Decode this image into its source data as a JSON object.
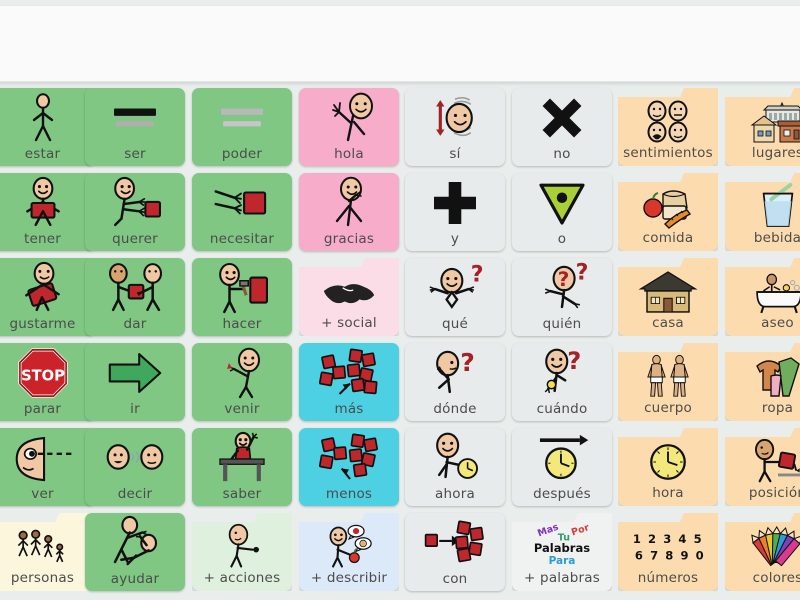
{
  "app": {
    "type": "aac-communication-board",
    "language": "es",
    "columns": 8,
    "rows": 6
  },
  "message_bar": {
    "name": "message-window",
    "value": "",
    "placeholder": ""
  },
  "palette": {
    "verb_green": "#7FC783",
    "social_pink": "#F7ACCA",
    "social_light_pink": "#FBDDE8",
    "question_gray": "#E7EBEC",
    "category_orange": "#FCDCAE",
    "quantity_blue": "#4DD0E1",
    "people_cream": "#FBF6DC",
    "actions_mint": "#DFF0DF",
    "describe_blue": "#DCE9F8",
    "words_gray": "#F0F2F2",
    "board_background": "#E9EDEC",
    "message_background": "#FAFAFA",
    "caption_text": "#4C4C4C"
  },
  "cells": [
    {
      "label": "estar",
      "icon": "standing-person-icon",
      "color": "verb_green",
      "folder": false,
      "row": 1,
      "col": 1
    },
    {
      "label": "ser",
      "icon": "two-bars-icon",
      "color": "verb_green",
      "folder": false,
      "row": 1,
      "col": 2
    },
    {
      "label": "poder",
      "icon": "two-gray-bars-icon",
      "color": "verb_green",
      "folder": false,
      "row": 1,
      "col": 3
    },
    {
      "label": "hola",
      "icon": "waving-person-icon",
      "color": "social_pink",
      "folder": false,
      "row": 1,
      "col": 4
    },
    {
      "label": "sí",
      "icon": "nodding-head-icon",
      "color": "question_gray",
      "folder": false,
      "row": 1,
      "col": 5
    },
    {
      "label": "no",
      "icon": "x-cross-icon",
      "color": "question_gray",
      "folder": false,
      "row": 1,
      "col": 6
    },
    {
      "label": "sentimientos",
      "icon": "four-faces-icon",
      "color": "category_orange",
      "folder": true,
      "row": 1,
      "col": 7
    },
    {
      "label": "lugares",
      "icon": "buildings-icon",
      "color": "category_orange",
      "folder": true,
      "row": 1,
      "col": 8
    },
    {
      "label": "tener",
      "icon": "person-holding-block-icon",
      "color": "verb_green",
      "folder": false,
      "row": 2,
      "col": 1
    },
    {
      "label": "querer",
      "icon": "person-reaching-icon",
      "color": "verb_green",
      "folder": false,
      "row": 2,
      "col": 2
    },
    {
      "label": "necesitar",
      "icon": "hands-grabbing-block-icon",
      "color": "verb_green",
      "folder": false,
      "row": 2,
      "col": 3
    },
    {
      "label": "gracias",
      "icon": "thank-you-sign-icon",
      "color": "social_pink",
      "folder": false,
      "row": 2,
      "col": 4
    },
    {
      "label": "y",
      "icon": "plus-sign-icon",
      "color": "question_gray",
      "folder": false,
      "row": 2,
      "col": 5
    },
    {
      "label": "o",
      "icon": "triangle-dot-icon",
      "color": "question_gray",
      "folder": false,
      "row": 2,
      "col": 6
    },
    {
      "label": "comida",
      "icon": "food-bread-apple-icon",
      "color": "category_orange",
      "folder": true,
      "row": 2,
      "col": 7
    },
    {
      "label": "bebida",
      "icon": "glass-with-straw-icon",
      "color": "category_orange",
      "folder": true,
      "row": 2,
      "col": 8
    },
    {
      "label": "gustarme",
      "icon": "person-hugging-heart-icon",
      "color": "verb_green",
      "folder": false,
      "row": 3,
      "col": 1
    },
    {
      "label": "dar",
      "icon": "two-people-giving-icon",
      "color": "verb_green",
      "folder": false,
      "row": 3,
      "col": 2
    },
    {
      "label": "hacer",
      "icon": "person-hammering-icon",
      "color": "verb_green",
      "folder": false,
      "row": 3,
      "col": 3
    },
    {
      "label": "+ social",
      "icon": "handshake-icon",
      "color": "social_light_pink",
      "folder": true,
      "row": 3,
      "col": 4
    },
    {
      "label": "qué",
      "icon": "shrug-question-icon",
      "color": "question_gray",
      "folder": false,
      "row": 3,
      "col": 5
    },
    {
      "label": "quién",
      "icon": "faceless-question-icon",
      "color": "question_gray",
      "folder": false,
      "row": 3,
      "col": 6
    },
    {
      "label": "casa",
      "icon": "house-icon",
      "color": "category_orange",
      "folder": true,
      "row": 3,
      "col": 7
    },
    {
      "label": "aseo",
      "icon": "bathtub-icon",
      "color": "category_orange",
      "folder": true,
      "row": 3,
      "col": 8
    },
    {
      "label": "parar",
      "icon": "stop-sign-icon",
      "color": "verb_green",
      "folder": false,
      "row": 4,
      "col": 1
    },
    {
      "label": "ir",
      "icon": "right-arrow-icon",
      "color": "verb_green",
      "folder": false,
      "row": 4,
      "col": 2
    },
    {
      "label": "venir",
      "icon": "person-beckoning-icon",
      "color": "verb_green",
      "folder": false,
      "row": 4,
      "col": 3
    },
    {
      "label": "más",
      "icon": "more-blocks-icon",
      "color": "quantity_blue",
      "folder": false,
      "row": 4,
      "col": 4
    },
    {
      "label": "dónde",
      "icon": "looking-question-icon",
      "color": "question_gray",
      "folder": false,
      "row": 4,
      "col": 5
    },
    {
      "label": "cuándo",
      "icon": "watch-question-icon",
      "color": "question_gray",
      "folder": false,
      "row": 4,
      "col": 6
    },
    {
      "label": "cuerpo",
      "icon": "two-bodies-icon",
      "color": "category_orange",
      "folder": true,
      "row": 4,
      "col": 7
    },
    {
      "label": "ropa",
      "icon": "clothing-icon",
      "color": "category_orange",
      "folder": true,
      "row": 4,
      "col": 8
    },
    {
      "label": "ver",
      "icon": "eye-looking-icon",
      "color": "verb_green",
      "folder": false,
      "row": 5,
      "col": 1
    },
    {
      "label": "decir",
      "icon": "two-faces-talking-icon",
      "color": "verb_green",
      "folder": false,
      "row": 5,
      "col": 2
    },
    {
      "label": "saber",
      "icon": "student-raising-hand-icon",
      "color": "verb_green",
      "folder": false,
      "row": 5,
      "col": 3
    },
    {
      "label": "menos",
      "icon": "less-blocks-icon",
      "color": "quantity_blue",
      "folder": false,
      "row": 5,
      "col": 4
    },
    {
      "label": "ahora",
      "icon": "person-pointing-clock-icon",
      "color": "question_gray",
      "folder": false,
      "row": 5,
      "col": 5
    },
    {
      "label": "después",
      "icon": "clock-arrow-icon",
      "color": "question_gray",
      "folder": false,
      "row": 5,
      "col": 6
    },
    {
      "label": "hora",
      "icon": "clock-icon",
      "color": "category_orange",
      "folder": true,
      "row": 5,
      "col": 7
    },
    {
      "label": "posición",
      "icon": "person-placing-block-icon",
      "color": "category_orange",
      "folder": true,
      "row": 5,
      "col": 8
    },
    {
      "label": "personas",
      "icon": "group-of-people-icon",
      "color": "people_cream",
      "folder": true,
      "row": 6,
      "col": 1
    },
    {
      "label": "ayudar",
      "icon": "person-helping-icon",
      "color": "verb_green",
      "folder": false,
      "row": 6,
      "col": 2
    },
    {
      "label": "+ acciones",
      "icon": "person-action-icon",
      "color": "actions_mint",
      "folder": true,
      "row": 6,
      "col": 3
    },
    {
      "label": "+ describir",
      "icon": "person-describing-icon",
      "color": "describe_blue",
      "folder": true,
      "row": 6,
      "col": 4
    },
    {
      "label": "con",
      "icon": "block-joining-group-icon",
      "color": "question_gray",
      "folder": false,
      "row": 6,
      "col": 5
    },
    {
      "label": "+ palabras",
      "icon": "word-cloud-icon",
      "color": "words_gray",
      "folder": true,
      "row": 6,
      "col": 6
    },
    {
      "label": "números",
      "icon": "digits-icon",
      "color": "category_orange",
      "folder": true,
      "row": 6,
      "col": 7
    },
    {
      "label": "colores",
      "icon": "crayons-icon",
      "color": "category_orange",
      "folder": true,
      "row": 6,
      "col": 8
    }
  ],
  "word_cloud_icon_text": {
    "mas": "Mas",
    "tu": "Tu",
    "por": "Por",
    "palabras": "Palabras",
    "para": "Para"
  },
  "digits_icon_text": {
    "line1": "1 2 3 4 5",
    "line2": "6 7 8 9 0"
  },
  "stop_sign_text": "STOP"
}
